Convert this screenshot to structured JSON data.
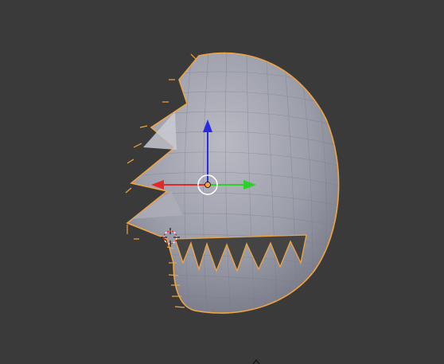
{
  "viewport": {
    "background_color": "#3a3a3a",
    "mesh_color": "#8d8f9b",
    "mesh_highlight_color": "#b9bac3",
    "selection_outline_color": "#f0a442",
    "axis_x_color": "#e02a2a",
    "axis_y_color": "#2ad12a",
    "axis_z_color": "#2a2ae0",
    "object_origin_color": "#f0a442",
    "widgets": {
      "transform_gizmo": "move-manipulator-icon",
      "pivot_point": "pivot-circle-icon",
      "cursor_3d": "3d-cursor-icon"
    }
  }
}
